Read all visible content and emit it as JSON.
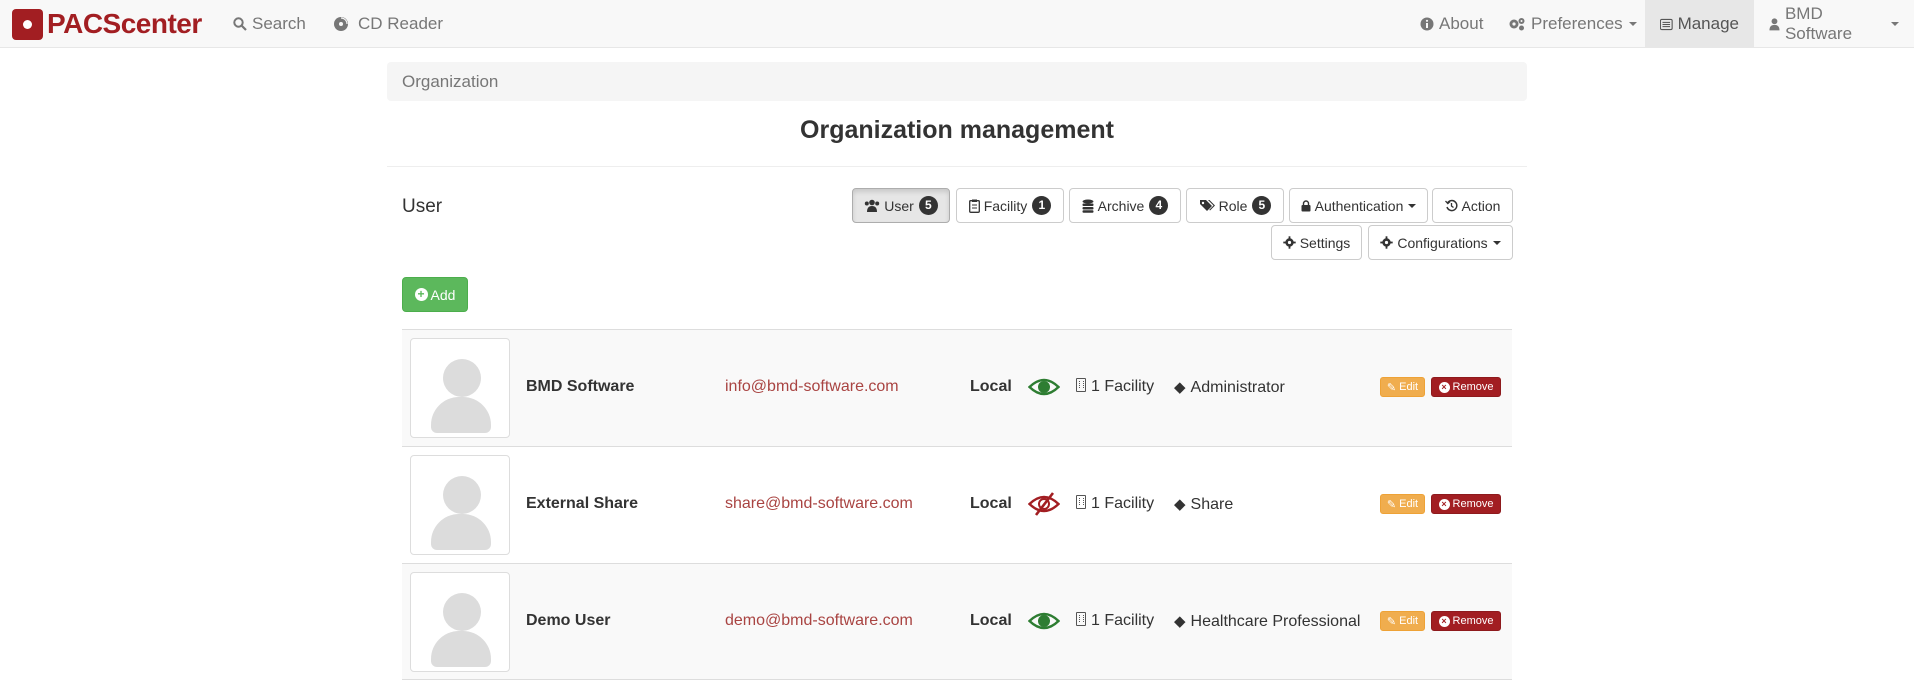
{
  "navbar": {
    "brand": "PACScenter",
    "search": "Search",
    "cd_reader": "CD Reader",
    "about": "About",
    "preferences": "Preferences",
    "manage": "Manage",
    "user_menu": "BMD Software"
  },
  "breadcrumb": "Organization",
  "page_title": "Organization management",
  "section_label": "User",
  "tabs": {
    "user": {
      "label": "User",
      "count": "5"
    },
    "facility": {
      "label": "Facility",
      "count": "1"
    },
    "archive": {
      "label": "Archive",
      "count": "4"
    },
    "role": {
      "label": "Role",
      "count": "5"
    },
    "authentication": "Authentication",
    "action": "Action",
    "settings": "Settings",
    "configurations": "Configurations"
  },
  "add_label": "Add",
  "users": [
    {
      "name": "BMD Software",
      "email": "info@bmd-software.com",
      "type": "Local",
      "visible": true,
      "facility": "1 Facility",
      "role": "Administrator"
    },
    {
      "name": "External Share",
      "email": "share@bmd-software.com",
      "type": "Local",
      "visible": false,
      "facility": "1 Facility",
      "role": "Share"
    },
    {
      "name": "Demo User",
      "email": "demo@bmd-software.com",
      "type": "Local",
      "visible": true,
      "facility": "1 Facility",
      "role": "Healthcare Professional"
    }
  ],
  "row_actions": {
    "edit": "Edit",
    "remove": "Remove"
  },
  "colors": {
    "brand": "#a21e22",
    "success": "#5cb85c",
    "warning": "#f0ad4e",
    "eye_visible": "#2e7d32",
    "eye_hidden": "#a21e22"
  }
}
